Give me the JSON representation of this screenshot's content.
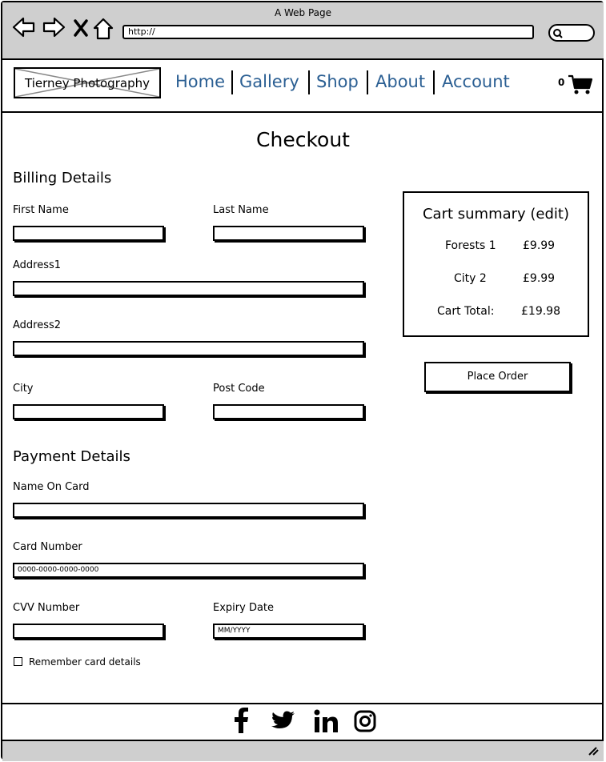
{
  "window": {
    "title": "A Web Page",
    "url": "http://"
  },
  "header": {
    "logo_text": "Tierney Photography",
    "nav": [
      {
        "label": "Home"
      },
      {
        "label": "Gallery"
      },
      {
        "label": "Shop"
      },
      {
        "label": "About"
      },
      {
        "label": "Account"
      }
    ],
    "cart_count": "0",
    "nav_color": "#2b5f93"
  },
  "page": {
    "title": "Checkout"
  },
  "billing": {
    "heading": "Billing Details",
    "first_name_label": "First Name",
    "last_name_label": "Last Name",
    "address1_label": "Address1",
    "address2_label": "Address2",
    "city_label": "City",
    "postcode_label": "Post Code"
  },
  "payment": {
    "heading": "Payment Details",
    "name_on_card_label": "Name On Card",
    "card_number_label": "Card Number",
    "card_number_placeholder": "0000-0000-0000-0000",
    "cvv_label": "CVV Number",
    "expiry_label": "Expiry Date",
    "expiry_placeholder": "MM/YYYY",
    "remember_label": "Remember card details"
  },
  "cart_summary": {
    "title": "Cart summary (edit)",
    "items": [
      {
        "name": "Forests 1",
        "price": "£9.99"
      },
      {
        "name": "City 2",
        "price": "£9.99"
      }
    ],
    "total_label": "Cart Total:",
    "total_value": "£19.98"
  },
  "order_button": "Place Order",
  "footer": {
    "icons": [
      "facebook-icon",
      "twitter-icon",
      "linkedin-icon",
      "instagram-icon"
    ]
  }
}
